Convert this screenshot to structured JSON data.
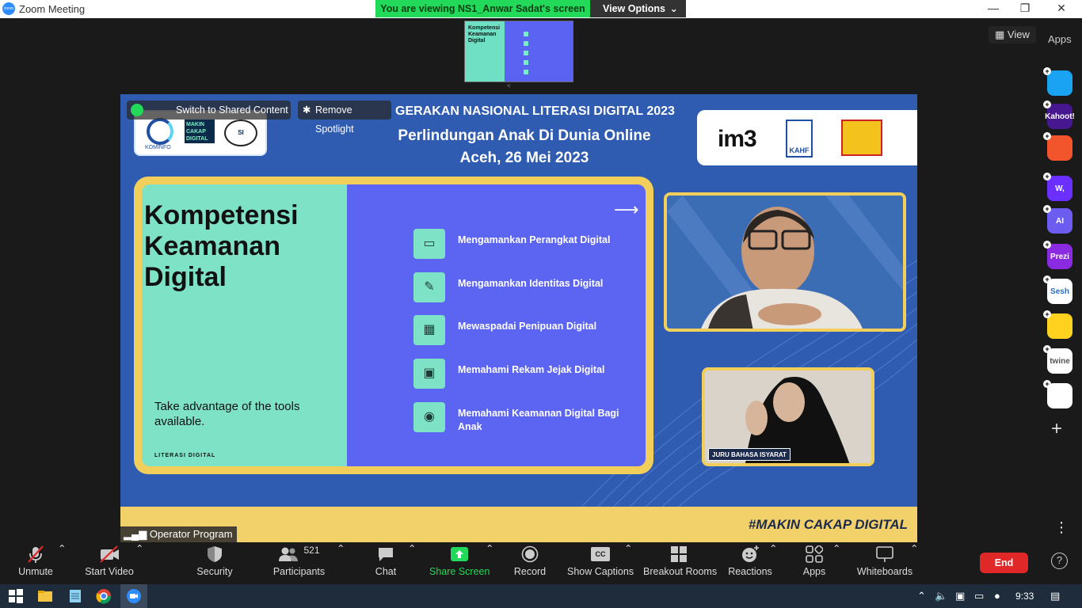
{
  "window": {
    "title": "Zoom Meeting",
    "app_logo_text": "zoom"
  },
  "banner": {
    "viewing_text": "You are viewing NS1_Anwar Sadat's screen",
    "view_options_label": "View Options"
  },
  "top_right": {
    "view_label": "View",
    "apps_label": "Apps"
  },
  "thumbnail": {
    "title": "Kompetensi Keamanan Digital",
    "nav": "<"
  },
  "apps_rail": [
    {
      "name": "App",
      "color": "#1aa3f2",
      "text": ""
    },
    {
      "name": "Kahoot",
      "color": "#46178f",
      "text": "Kahoot!"
    },
    {
      "name": "App",
      "color": "#f2552c",
      "text": ""
    },
    {
      "name": "Wooclap",
      "color": "#6b30ff",
      "text": "W,"
    },
    {
      "name": "App",
      "color": "#6d5cf0",
      "text": "AI"
    },
    {
      "name": "Prezi",
      "color": "#8a2be2",
      "text": "Prezi"
    },
    {
      "name": "Sesh",
      "color": "#ffffff",
      "text": "Sesh"
    },
    {
      "name": "App",
      "color": "#ffd21f",
      "text": ""
    },
    {
      "name": "Twine",
      "color": "#ffffff",
      "text": "twine"
    },
    {
      "name": "App",
      "color": "#ffffff",
      "text": ""
    }
  ],
  "stage_controls": {
    "switch_label": "Switch to Shared Content",
    "remove_spotlight_label": "Remove Spotlight"
  },
  "shared_screen": {
    "kominfo_label": "KOMINFO",
    "makin_cakap_label": "MAKIN CAKAP DIGITAL",
    "siberkreasi_label": "SI",
    "heading1": "GERAKAN NASIONAL LITERASI DIGITAL 2023",
    "heading2": "Perlindungan Anak Di Dunia Online",
    "heading3": "Aceh, 26 Mei 2023",
    "sponsor_im3": "im3",
    "sponsor_kahf": "KAHF",
    "hashtag": "#MAKIN CAKAP DIGITAL",
    "slide": {
      "title": "Kompetensi Keamanan Digital",
      "subtitle": "Take advantage of the tools available.",
      "footer": "LITERASI DIGITAL",
      "items": [
        {
          "text": "Mengamankan Perangkat Digital",
          "icon": "▭"
        },
        {
          "text": "Mengamankan Identitas Digital",
          "icon": "✎"
        },
        {
          "text": "Mewaspadai Penipuan Digital",
          "icon": "▦"
        },
        {
          "text": "Memahami Rekam Jejak Digital",
          "icon": "▣"
        },
        {
          "text": "Memahami Keamanan Digital Bagi Anak",
          "icon": "◉"
        }
      ]
    },
    "interpreter_tag": "JURU BAHASA ISYARAT"
  },
  "operator": {
    "name": "Operator Program"
  },
  "toolbar": {
    "unmute": "Unmute",
    "start_video": "Start Video",
    "security": "Security",
    "participants": "Participants",
    "participants_count": "521",
    "chat": "Chat",
    "share_screen": "Share Screen",
    "record": "Record",
    "show_captions": "Show Captions",
    "cc": "CC",
    "breakout_rooms": "Breakout Rooms",
    "reactions": "Reactions",
    "apps": "Apps",
    "whiteboards": "Whiteboards",
    "end": "End",
    "help": "?"
  },
  "taskbar": {
    "time": "9:33"
  }
}
